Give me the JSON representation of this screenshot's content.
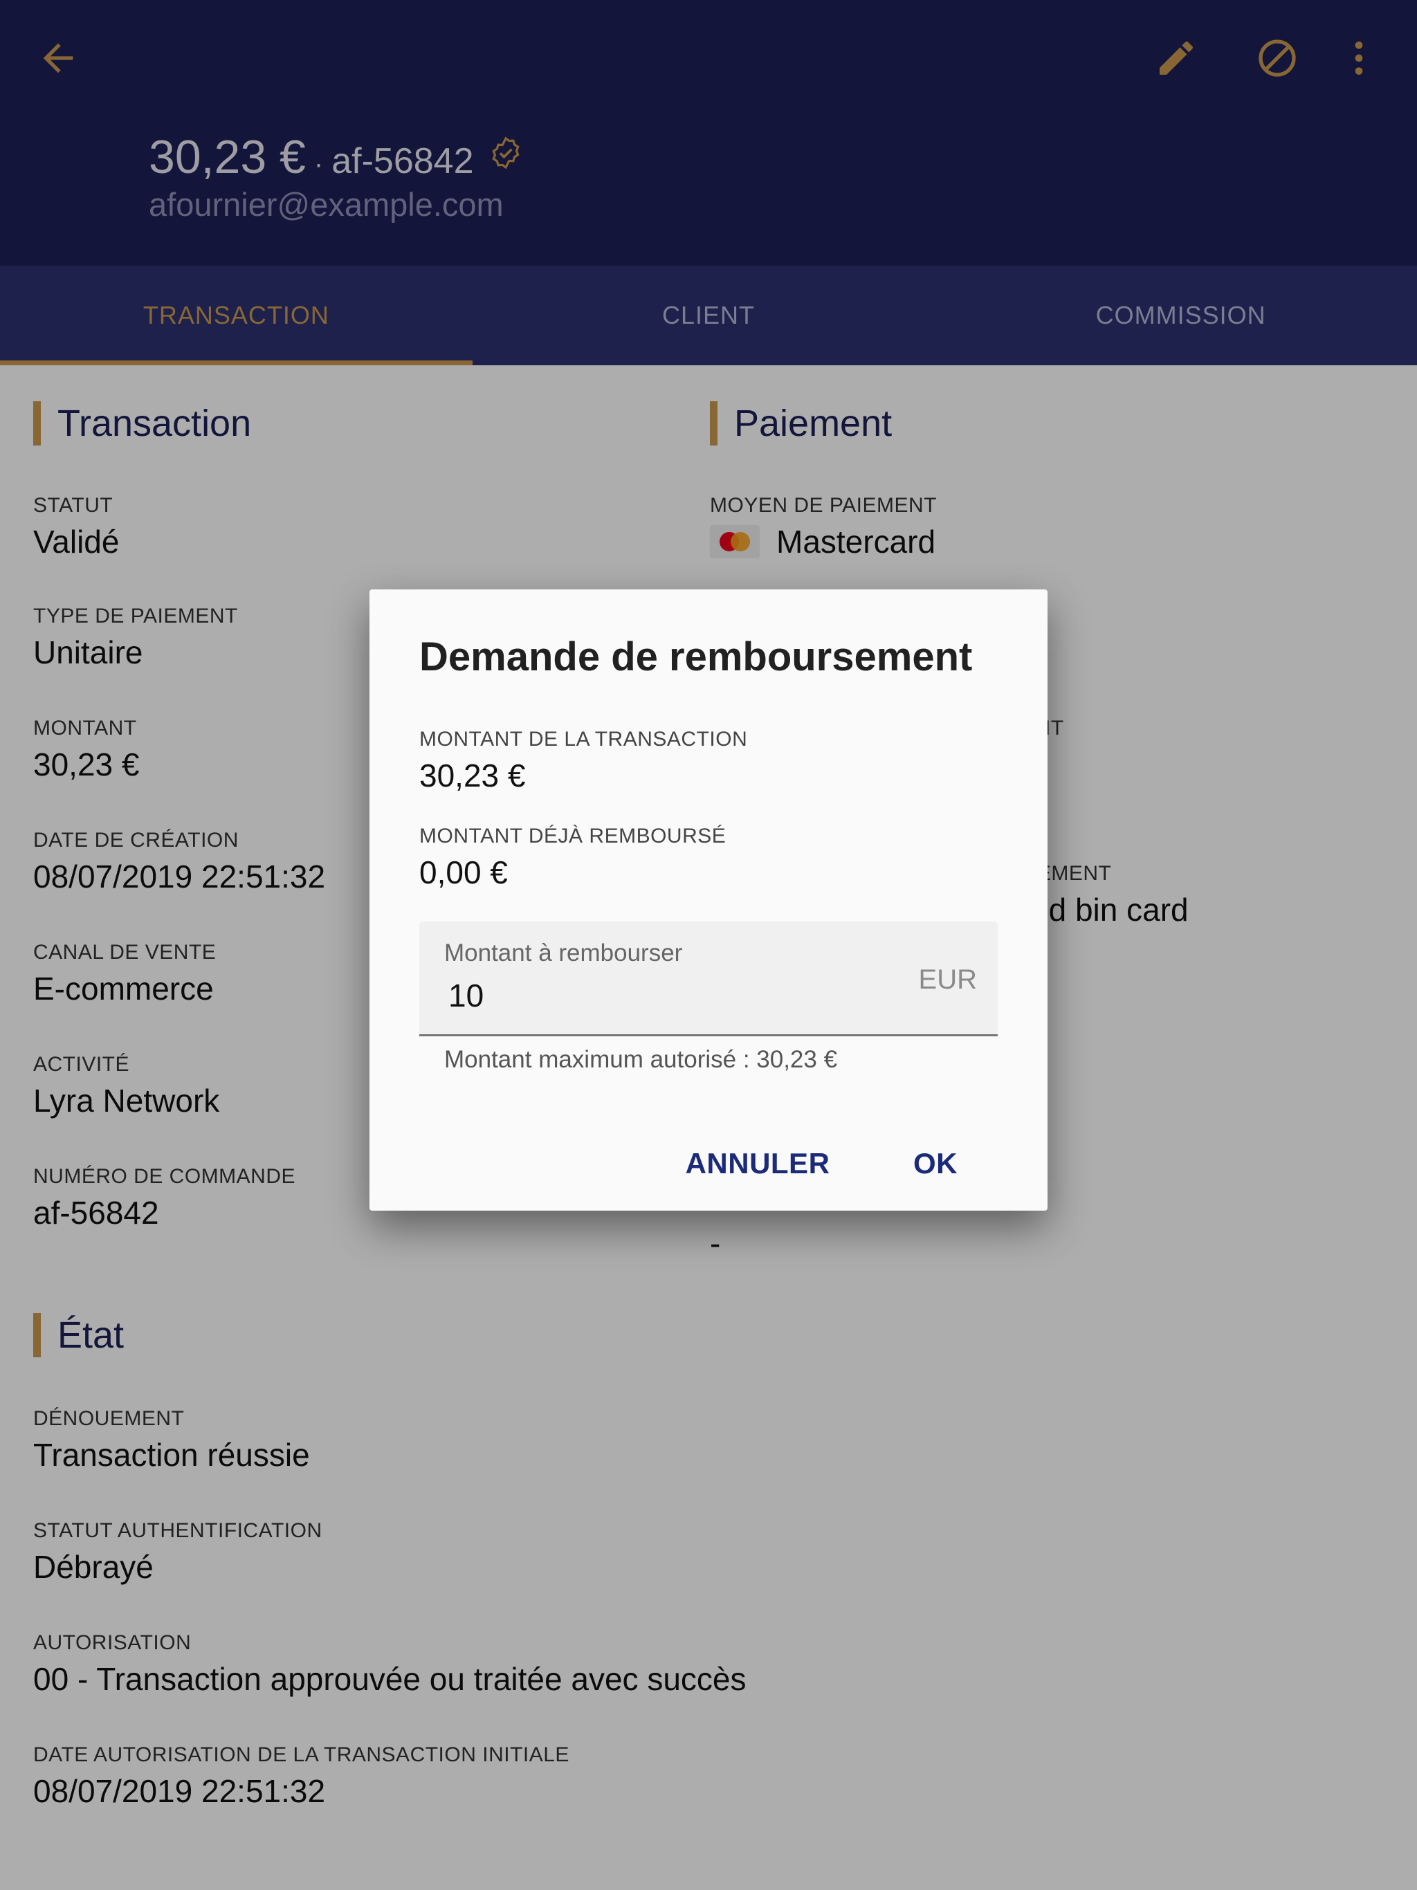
{
  "header": {
    "amount": "30,23 €",
    "separator": "·",
    "order_ref": "af-56842",
    "email": "afournier@example.com",
    "back_icon": "arrow-back-icon",
    "edit_icon": "pencil-icon",
    "cancel_icon": "block-icon",
    "more_icon": "more-vert-icon",
    "verified_icon": "verified-badge-icon",
    "accent_color": "#c9994d",
    "bg_color": "#1c2056"
  },
  "tabs": [
    {
      "label": "TRANSACTION",
      "active": true
    },
    {
      "label": "CLIENT",
      "active": false
    },
    {
      "label": "COMMISSION",
      "active": false
    }
  ],
  "transaction": {
    "title": "Transaction",
    "fields": [
      {
        "label": "STATUT",
        "value": "Validé"
      },
      {
        "label": "TYPE DE PAIEMENT",
        "value": "Unitaire"
      },
      {
        "label": "MONTANT",
        "value": "30,23 €"
      },
      {
        "label": "DATE DE CRÉATION",
        "value": "08/07/2019 22:51:32"
      },
      {
        "label": "CANAL DE VENTE",
        "value": "E-commerce"
      },
      {
        "label": "ACTIVITÉ",
        "value": "Lyra Network"
      },
      {
        "label": "NUMÉRO DE COMMANDE",
        "value": "af-56842"
      }
    ]
  },
  "paiement": {
    "title": "Paiement",
    "fields": [
      {
        "label": "MOYEN DE PAIEMENT",
        "value": "Mastercard",
        "icon": "mastercard-icon"
      },
      {
        "label": "IT",
        "value": ""
      },
      {
        "label": "IEMENT",
        "value": "ed bin card"
      },
      {
        "label": "",
        "value": "-"
      }
    ]
  },
  "etat": {
    "title": "État",
    "fields": [
      {
        "label": "DÉNOUEMENT",
        "value": "Transaction réussie"
      },
      {
        "label": "STATUT AUTHENTIFICATION",
        "value": "Débrayé"
      },
      {
        "label": "AUTORISATION",
        "value": "00 - Transaction approuvée ou traitée avec succès"
      },
      {
        "label": "DATE AUTORISATION DE LA TRANSACTION INITIALE",
        "value": "08/07/2019 22:51:32"
      }
    ]
  },
  "dialog": {
    "title": "Demande de remboursement",
    "transaction_amount_label": "MONTANT DE LA TRANSACTION",
    "transaction_amount_value": "30,23 €",
    "refunded_label": "MONTANT DÉJÀ REMBOURSÉ",
    "refunded_value": "0,00 €",
    "input_label": "Montant à rembourser",
    "input_value": "10",
    "input_suffix": "EUR",
    "helper": "Montant maximum autorisé : 30,23 €",
    "cancel_label": "ANNULER",
    "ok_label": "OK"
  }
}
